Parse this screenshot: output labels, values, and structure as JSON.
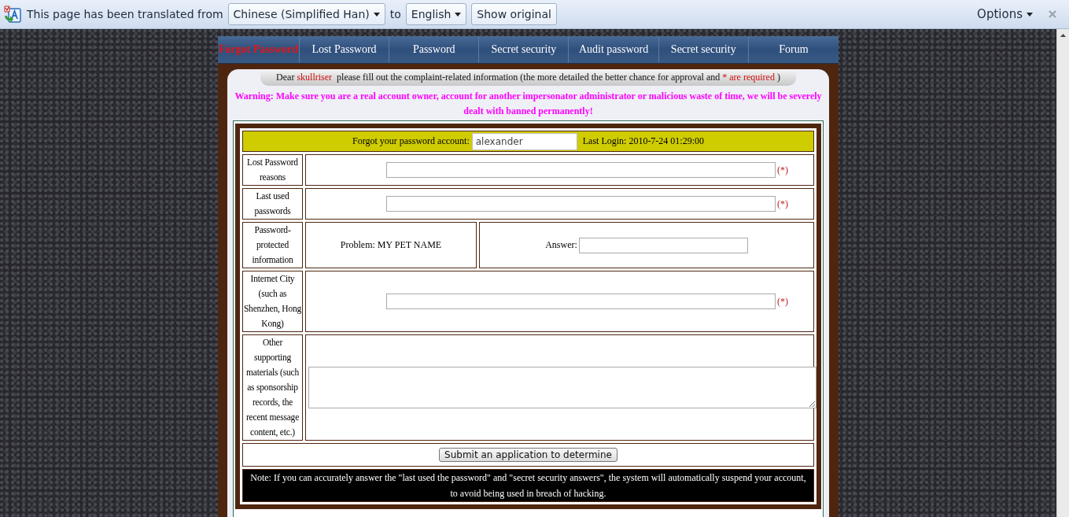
{
  "translate_bar": {
    "message": "This page has been translated from",
    "from_language": "Chinese (Simplified Han)",
    "connector": "to",
    "to_language": "English",
    "show_original_button": "Show original",
    "options_menu": "Options"
  },
  "nav": {
    "items": [
      {
        "label": "Forgot Password",
        "selected": true
      },
      {
        "label": "Lost Password",
        "selected": false
      },
      {
        "label": "Password",
        "selected": false
      },
      {
        "label": "Secret security",
        "selected": false
      },
      {
        "label": "Audit password",
        "selected": false
      },
      {
        "label": "Secret security",
        "selected": false
      },
      {
        "label": "Forum",
        "selected": false
      }
    ]
  },
  "notice": {
    "greeting": "Dear",
    "username": "skullriser",
    "text": "please fill out the complaint-related information (the more detailed the better chance for approval and",
    "required_note": "* are required",
    "closing": ")"
  },
  "warning": "Warning: Make sure you are a real account owner, account for another impersonator administrator or malicious waste of time, we will be severely dealt with banned permanently!",
  "form": {
    "account_label": "Forgot your password account:",
    "account_value": "alexander",
    "last_login_label": "Last Login:",
    "last_login_value": "2010-7-24 01:29:00",
    "rows": [
      {
        "kind": "text",
        "label": "Lost Password reasons",
        "required_mark": "(*)"
      },
      {
        "kind": "text",
        "label": "Last used passwords",
        "required_mark": "(*)"
      },
      {
        "kind": "question",
        "label": "Password-protected information",
        "problem": "Problem: MY PET NAME",
        "answer_label": "Answer:"
      },
      {
        "kind": "text",
        "label": "Internet City (such as Shenzhen, Hong Kong)",
        "required_mark": "(*)"
      },
      {
        "kind": "textarea",
        "label": "Other supporting materials (such as sponsorship records, the recent message content, etc.)"
      }
    ],
    "submit_button": "Submit an application to determine",
    "note": "Note: If you can accurately answer the \"last used the password\" and \"secret security answers\", the system will automatically suspend your account, to avoid being used in breach of hacking."
  }
}
